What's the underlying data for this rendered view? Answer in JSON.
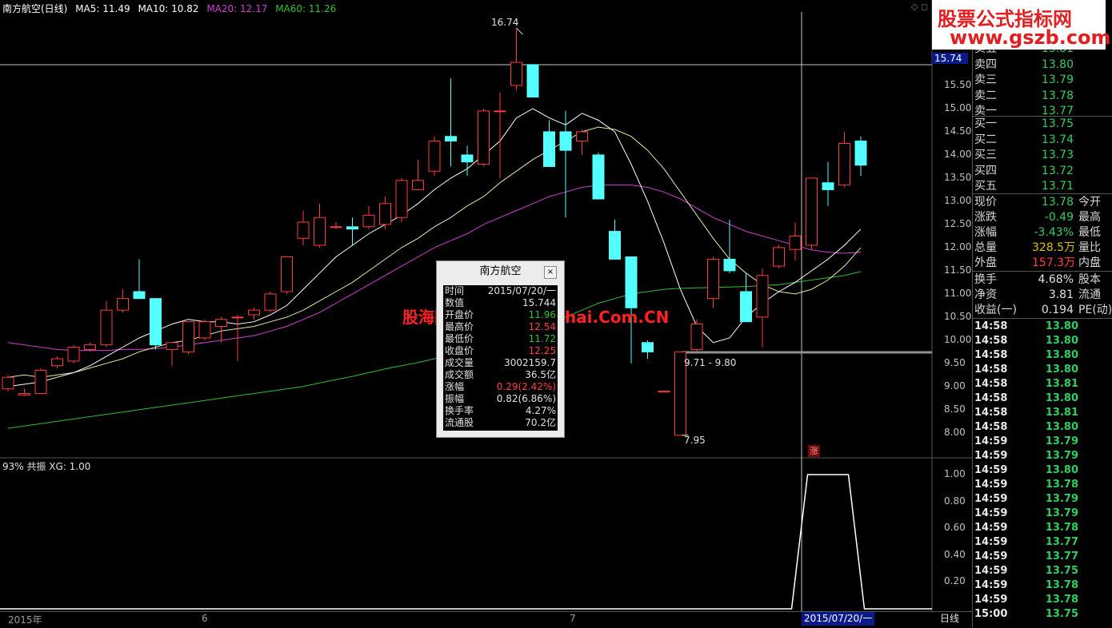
{
  "header": {
    "stock_title": "南方航空(日线)",
    "ma5": "MA5: 11.49",
    "ma10": "MA10: 10.82",
    "ma20": "MA20: 12.17",
    "ma60": "MA60: 11.26",
    "colors": {
      "ma5": "#ffffff",
      "ma10": "#ffffff",
      "ma20": "#d040d0",
      "ma60": "#30c030"
    }
  },
  "indicator": {
    "title": "93% 共振 XG: 1.00"
  },
  "price_axis": [
    "15.50",
    "15.00",
    "14.50",
    "14.00",
    "13.50",
    "13.00",
    "12.50",
    "12.00",
    "11.50",
    "11.00",
    "10.50",
    "10.00",
    "9.50",
    "9.00",
    "8.50",
    "8.00"
  ],
  "indicator_axis": [
    "1.00",
    "0.80",
    "0.60",
    "0.40",
    "0.20"
  ],
  "cursor_price": "15.74",
  "annotations": {
    "high": "16.74",
    "low": "7.95",
    "range": "9.71 - 9.80",
    "zhang": "涨"
  },
  "bottom": {
    "year": "2015年",
    "month6": "6",
    "month7": "7",
    "cursor_date": "2015/07/20/一",
    "period": "日线"
  },
  "watermark": {
    "top_line1": "股票公式指标网",
    "top_line2": "www.gszb.com",
    "mid": "股海网提供 Www.Guhai.Com.CN"
  },
  "info_box": {
    "title": "南方航空",
    "rows": [
      {
        "label": "时间",
        "value": "2015/07/20/一",
        "color": "#e0e0e0"
      },
      {
        "label": "数值",
        "value": "15.744",
        "color": "#e0e0e0"
      },
      {
        "label": "开盘价",
        "value": "11.96",
        "color": "#30c030"
      },
      {
        "label": "最高价",
        "value": "12.54",
        "color": "#ff4040"
      },
      {
        "label": "最低价",
        "value": "11.72",
        "color": "#30c030"
      },
      {
        "label": "收盘价",
        "value": "12.25",
        "color": "#ff4040"
      },
      {
        "label": "成交量",
        "value": "3002159.7",
        "color": "#e0e0e0"
      },
      {
        "label": "成交额",
        "value": "36.5亿",
        "color": "#e0e0e0"
      },
      {
        "label": "涨幅",
        "value": "0.29(2.42%)",
        "color": "#ff4040"
      },
      {
        "label": "振幅",
        "value": "0.82(6.86%)",
        "color": "#e0e0e0"
      },
      {
        "label": "换手率",
        "value": "4.27%",
        "color": "#e0e0e0"
      },
      {
        "label": "流通股",
        "value": "70.2亿",
        "color": "#e0e0e0"
      }
    ]
  },
  "quote": {
    "asks": [
      {
        "label": "卖五",
        "price": "13.81"
      },
      {
        "label": "卖四",
        "price": "13.80"
      },
      {
        "label": "卖三",
        "price": "13.79"
      },
      {
        "label": "卖二",
        "price": "13.78"
      },
      {
        "label": "卖一",
        "price": "13.77"
      }
    ],
    "bids": [
      {
        "label": "买一",
        "price": "13.75"
      },
      {
        "label": "买二",
        "price": "13.74"
      },
      {
        "label": "买三",
        "price": "13.73"
      },
      {
        "label": "买四",
        "price": "13.72"
      },
      {
        "label": "买五",
        "price": "13.71"
      }
    ],
    "stats": [
      {
        "label": "现价",
        "value": "13.78",
        "color": "#30d060",
        "label2": "今开"
      },
      {
        "label": "涨跌",
        "value": "-0.49",
        "color": "#30d060",
        "label2": "最高"
      },
      {
        "label": "涨幅",
        "value": "-3.43%",
        "color": "#30d060",
        "label2": "最低"
      },
      {
        "label": "总量",
        "value": "328.5万",
        "color": "#e0c000",
        "label2": "量比"
      },
      {
        "label": "外盘",
        "value": "157.3万",
        "color": "#ff4040",
        "label2": "内盘"
      }
    ],
    "stats2": [
      {
        "label": "换手",
        "value": "4.68%",
        "color": "#e0e0e0",
        "label2": "股本"
      },
      {
        "label": "净资",
        "value": "3.81",
        "color": "#e0e0e0",
        "label2": "流通"
      },
      {
        "label": "收益(一)",
        "value": "0.194",
        "color": "#e0e0e0",
        "label2": "PE(动)"
      }
    ]
  },
  "ticks": [
    {
      "time": "14:58",
      "price": "13.80"
    },
    {
      "time": "14:58",
      "price": "13.80"
    },
    {
      "time": "14:58",
      "price": "13.80"
    },
    {
      "time": "14:58",
      "price": "13.80"
    },
    {
      "time": "14:58",
      "price": "13.81"
    },
    {
      "time": "14:58",
      "price": "13.80"
    },
    {
      "time": "14:58",
      "price": "13.81"
    },
    {
      "time": "14:58",
      "price": "13.80"
    },
    {
      "time": "14:59",
      "price": "13.79"
    },
    {
      "time": "14:59",
      "price": "13.79"
    },
    {
      "time": "14:59",
      "price": "13.80"
    },
    {
      "time": "14:59",
      "price": "13.78"
    },
    {
      "time": "14:59",
      "price": "13.79"
    },
    {
      "time": "14:59",
      "price": "13.79"
    },
    {
      "time": "14:59",
      "price": "13.78"
    },
    {
      "time": "14:59",
      "price": "13.77"
    },
    {
      "time": "14:59",
      "price": "13.77"
    },
    {
      "time": "14:59",
      "price": "13.75"
    },
    {
      "time": "14:59",
      "price": "13.78"
    },
    {
      "time": "14:59",
      "price": "13.78"
    },
    {
      "time": "15:00",
      "price": "13.75"
    }
  ],
  "chart_data": {
    "type": "candlestick",
    "y_range": [
      7.6,
      17.0
    ],
    "candles": [
      {
        "o": 8.95,
        "h": 9.25,
        "l": 8.9,
        "c": 9.2
      },
      {
        "o": 8.82,
        "h": 8.95,
        "l": 8.8,
        "c": 8.85
      },
      {
        "o": 8.85,
        "h": 9.4,
        "l": 8.85,
        "c": 9.35
      },
      {
        "o": 9.45,
        "h": 9.65,
        "l": 9.4,
        "c": 9.6
      },
      {
        "o": 9.55,
        "h": 9.9,
        "l": 9.5,
        "c": 9.85
      },
      {
        "o": 9.8,
        "h": 9.95,
        "l": 9.75,
        "c": 9.9
      },
      {
        "o": 9.9,
        "h": 10.85,
        "l": 9.85,
        "c": 10.65
      },
      {
        "o": 10.65,
        "h": 11.1,
        "l": 10.6,
        "c": 10.9
      },
      {
        "o": 11.05,
        "h": 11.75,
        "l": 10.95,
        "c": 10.9
      },
      {
        "o": 10.9,
        "h": 10.9,
        "l": 9.8,
        "c": 9.9
      },
      {
        "o": 9.8,
        "h": 9.95,
        "l": 9.45,
        "c": 9.95
      },
      {
        "o": 9.75,
        "h": 10.4,
        "l": 9.7,
        "c": 10.4
      },
      {
        "o": 10.05,
        "h": 10.45,
        "l": 10.0,
        "c": 10.4
      },
      {
        "o": 10.3,
        "h": 10.5,
        "l": 9.95,
        "c": 10.45
      },
      {
        "o": 10.5,
        "h": 10.55,
        "l": 9.55,
        "c": 10.5
      },
      {
        "o": 10.55,
        "h": 10.7,
        "l": 10.45,
        "c": 10.65
      },
      {
        "o": 10.65,
        "h": 11.05,
        "l": 10.6,
        "c": 11.0
      },
      {
        "o": 11.05,
        "h": 11.8,
        "l": 11.0,
        "c": 11.8
      },
      {
        "o": 12.2,
        "h": 12.8,
        "l": 12.05,
        "c": 12.55
      },
      {
        "o": 12.05,
        "h": 12.95,
        "l": 12.0,
        "c": 12.65
      },
      {
        "o": 12.45,
        "h": 12.55,
        "l": 12.4,
        "c": 12.45
      },
      {
        "o": 12.45,
        "h": 12.65,
        "l": 12.05,
        "c": 12.4
      },
      {
        "o": 12.45,
        "h": 12.9,
        "l": 12.4,
        "c": 12.7
      },
      {
        "o": 12.5,
        "h": 13.1,
        "l": 12.4,
        "c": 12.95
      },
      {
        "o": 12.65,
        "h": 13.5,
        "l": 12.55,
        "c": 13.45
      },
      {
        "o": 13.25,
        "h": 13.9,
        "l": 13.25,
        "c": 13.45
      },
      {
        "o": 13.65,
        "h": 14.4,
        "l": 13.55,
        "c": 14.3
      },
      {
        "o": 14.4,
        "h": 15.65,
        "l": 13.75,
        "c": 14.3
      },
      {
        "o": 14.0,
        "h": 14.2,
        "l": 13.55,
        "c": 13.85
      },
      {
        "o": 13.8,
        "h": 15.0,
        "l": 13.75,
        "c": 14.95
      },
      {
        "o": 14.95,
        "h": 15.35,
        "l": 13.5,
        "c": 14.95
      },
      {
        "o": 15.5,
        "h": 16.74,
        "l": 15.4,
        "c": 16.0
      },
      {
        "o": 15.95,
        "h": 15.95,
        "l": 15.25,
        "c": 15.25
      },
      {
        "o": 14.5,
        "h": 14.75,
        "l": 13.9,
        "c": 13.75
      },
      {
        "o": 14.5,
        "h": 14.95,
        "l": 12.65,
        "c": 14.1
      },
      {
        "o": 14.3,
        "h": 14.55,
        "l": 14.0,
        "c": 14.5
      },
      {
        "o": 14.0,
        "h": 14.05,
        "l": 13.05,
        "c": 13.05
      },
      {
        "o": 12.35,
        "h": 12.6,
        "l": 11.75,
        "c": 11.75
      },
      {
        "o": 11.8,
        "h": 11.8,
        "l": 9.5,
        "c": 10.7
      },
      {
        "o": 9.95,
        "h": 10.0,
        "l": 9.6,
        "c": 9.75
      },
      {
        "o": 8.9,
        "h": 8.9,
        "l": 8.9,
        "c": 8.9
      },
      {
        "o": 7.95,
        "h": 9.75,
        "l": 7.95,
        "c": 9.75
      },
      {
        "o": 9.8,
        "h": 10.45,
        "l": 9.75,
        "c": 10.35
      },
      {
        "o": 10.9,
        "h": 11.8,
        "l": 10.7,
        "c": 11.75
      },
      {
        "o": 11.75,
        "h": 12.6,
        "l": 11.45,
        "c": 11.5
      },
      {
        "o": 11.05,
        "h": 11.45,
        "l": 10.6,
        "c": 10.4
      },
      {
        "o": 10.5,
        "h": 11.55,
        "l": 9.85,
        "c": 11.4
      },
      {
        "o": 11.6,
        "h": 12.05,
        "l": 11.55,
        "c": 12.0
      },
      {
        "o": 11.96,
        "h": 12.54,
        "l": 11.72,
        "c": 12.25
      },
      {
        "o": 12.05,
        "h": 13.5,
        "l": 11.95,
        "c": 13.5
      },
      {
        "o": 13.4,
        "h": 13.85,
        "l": 12.9,
        "c": 13.25
      },
      {
        "o": 13.35,
        "h": 14.5,
        "l": 13.3,
        "c": 14.25
      },
      {
        "o": 14.3,
        "h": 14.4,
        "l": 13.55,
        "c": 13.78
      }
    ],
    "ma5": [
      9.0,
      9.05,
      9.1,
      9.2,
      9.3,
      9.45,
      9.65,
      9.85,
      10.05,
      10.2,
      10.35,
      10.45,
      10.4,
      10.4,
      10.35,
      10.4,
      10.55,
      10.75,
      11.1,
      11.45,
      11.8,
      12.05,
      12.3,
      12.5,
      12.7,
      12.95,
      13.25,
      13.5,
      13.7,
      14.0,
      14.3,
      14.8,
      15.0,
      14.8,
      14.65,
      14.9,
      14.75,
      14.5,
      13.8,
      13.0,
      12.1,
      11.1,
      10.3,
      9.95,
      10.05,
      10.5,
      10.8,
      11.05,
      11.25,
      11.5,
      11.75,
      12.05,
      12.4
    ],
    "ma10": [
      9.2,
      9.25,
      9.2,
      9.25,
      9.3,
      9.4,
      9.5,
      9.6,
      9.75,
      9.85,
      9.95,
      10.0,
      10.1,
      10.2,
      10.25,
      10.3,
      10.4,
      10.5,
      10.65,
      10.85,
      11.05,
      11.25,
      11.5,
      11.75,
      12.0,
      12.2,
      12.45,
      12.65,
      12.9,
      13.1,
      13.4,
      13.65,
      13.9,
      14.1,
      14.3,
      14.5,
      14.6,
      14.55,
      14.4,
      14.1,
      13.7,
      13.2,
      12.7,
      12.2,
      11.75,
      11.45,
      11.2,
      11.05,
      11.0,
      11.1,
      11.3,
      11.6,
      12.0
    ],
    "ma20": [
      9.95,
      9.9,
      9.85,
      9.8,
      9.78,
      9.78,
      9.78,
      9.8,
      9.8,
      9.82,
      9.85,
      9.9,
      9.95,
      10.0,
      10.05,
      10.1,
      10.2,
      10.3,
      10.45,
      10.6,
      10.8,
      11.0,
      11.2,
      11.4,
      11.6,
      11.8,
      12.0,
      12.15,
      12.3,
      12.5,
      12.65,
      12.8,
      12.95,
      13.1,
      13.2,
      13.3,
      13.35,
      13.35,
      13.35,
      13.3,
      13.2,
      13.05,
      12.85,
      12.65,
      12.5,
      12.35,
      12.25,
      12.15,
      12.05,
      11.95,
      11.9,
      11.88,
      11.9
    ],
    "ma60": [
      8.1,
      8.15,
      8.2,
      8.25,
      8.3,
      8.35,
      8.4,
      8.45,
      8.5,
      8.55,
      8.6,
      8.65,
      8.7,
      8.75,
      8.8,
      8.85,
      8.9,
      8.95,
      9.0,
      9.08,
      9.15,
      9.22,
      9.3,
      9.38,
      9.45,
      9.52,
      9.6,
      9.68,
      9.75,
      9.85,
      9.95,
      10.05,
      10.2,
      10.35,
      10.5,
      10.65,
      10.8,
      10.9,
      11.0,
      11.05,
      11.1,
      11.12,
      11.13,
      11.14,
      11.15,
      11.16,
      11.18,
      11.2,
      11.25,
      11.3,
      11.35,
      11.4,
      11.48
    ],
    "indicator": {
      "name": "XG",
      "values_nonzero_span": [
        49,
        51
      ],
      "peak": 1.0
    }
  }
}
